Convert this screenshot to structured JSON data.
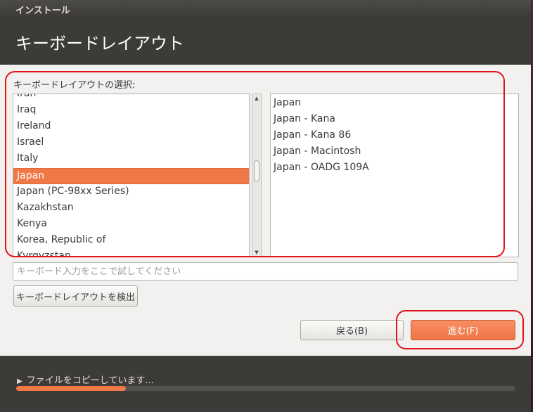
{
  "window": {
    "title": "インストール",
    "heading": "キーボードレイアウト"
  },
  "layout_section": {
    "label": "キーボードレイアウトの選択:",
    "layouts": [
      "Iran",
      "Iraq",
      "Ireland",
      "Israel",
      "Italy",
      "Japan",
      "Japan (PC-98xx Series)",
      "Kazakhstan",
      "Kenya",
      "Korea, Republic of",
      "Kyrgyzstan"
    ],
    "selected": "Japan",
    "variants": [
      "Japan",
      "Japan - Kana",
      "Japan - Kana 86",
      "Japan - Macintosh",
      "Japan - OADG 109A"
    ]
  },
  "test_input": {
    "value": "",
    "placeholder": "キーボード入力をここで試してください"
  },
  "buttons": {
    "detect": "キーボードレイアウトを検出",
    "back": "戻る(B)",
    "forward": "進む(F)"
  },
  "footer": {
    "status": "ファイルをコピーしています...",
    "progress": 0.22
  },
  "icons": {
    "scroll_up": "scroll-up-arrow-icon",
    "scroll_down": "scroll-down-arrow-icon",
    "expander": "expander-triangle-icon"
  },
  "colors": {
    "accent": "#f07746",
    "header_bg": "#3c3b37",
    "annotation": "#e2141b"
  }
}
